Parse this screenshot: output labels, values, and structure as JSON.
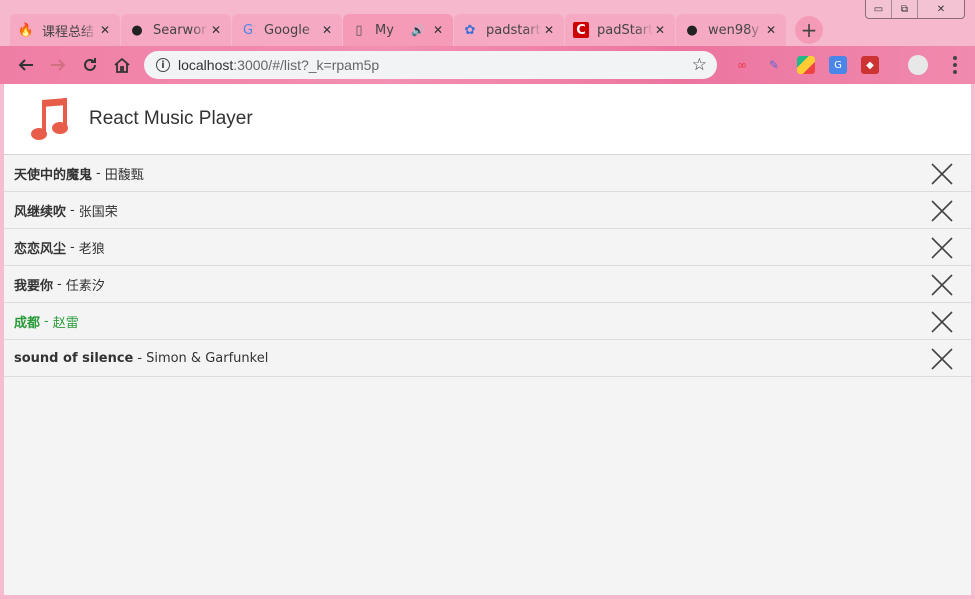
{
  "window": {
    "controls": {
      "minimize": "▭",
      "maximize": "⧉",
      "close": "✕"
    }
  },
  "tabs": [
    {
      "title": "课程总结",
      "icon": "flame-icon",
      "active": false,
      "audio": false
    },
    {
      "title": "Searwor",
      "icon": "github-icon",
      "active": false,
      "audio": false
    },
    {
      "title": "Google",
      "icon": "google-translate-icon",
      "active": false,
      "audio": false
    },
    {
      "title": "My",
      "icon": "page-icon",
      "active": true,
      "audio": true
    },
    {
      "title": "padstart",
      "icon": "paw-icon",
      "active": false,
      "audio": false
    },
    {
      "title": "padStart",
      "icon": "c-logo-icon",
      "active": false,
      "audio": false
    },
    {
      "title": "wen98y",
      "icon": "github-icon",
      "active": false,
      "audio": false
    }
  ],
  "tab_close": "✕",
  "new_tab": "+",
  "address": {
    "host": "localhost",
    "rest": ":3000/#/list?_k=rpam5p"
  },
  "app": {
    "title": "React Music Player",
    "separator": "-",
    "accent": "#e85d4a",
    "current_color": "#2a9b3a",
    "songs": [
      {
        "title": "天使中的魔鬼",
        "artist": "田馥甄",
        "current": false
      },
      {
        "title": "风继续吹",
        "artist": "张国荣",
        "current": false
      },
      {
        "title": "恋恋风尘",
        "artist": "老狼",
        "current": false
      },
      {
        "title": "我要你",
        "artist": "任素汐",
        "current": false
      },
      {
        "title": "成都",
        "artist": "赵雷",
        "current": true
      },
      {
        "title": "sound of silence",
        "artist": "Simon & Garfunkel",
        "current": false
      }
    ]
  }
}
